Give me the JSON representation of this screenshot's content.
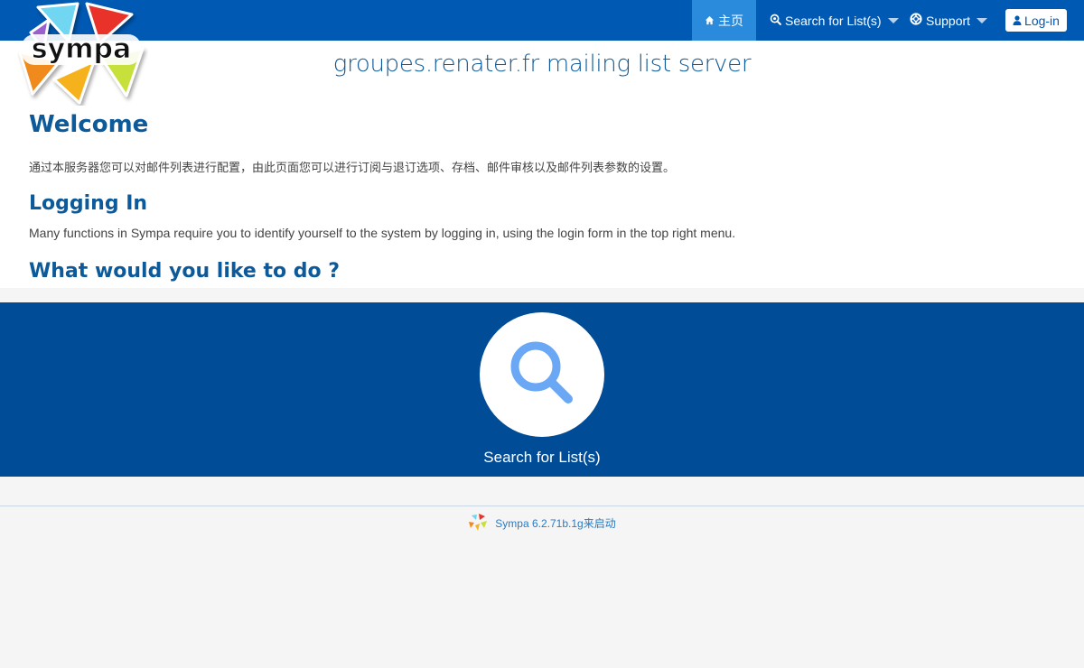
{
  "header": {
    "nav": {
      "home_label": "主页",
      "search_label": "Search for List(s)",
      "support_label": "Support",
      "login_label": "Log-in"
    },
    "icons": {
      "home": "home-icon",
      "search": "search-icon",
      "support": "lifebuoy-icon",
      "login": "user-icon"
    },
    "colors": {
      "topbar": "#0059b3",
      "active_tab": "#2a8bdc",
      "heading": "#0d5a9a",
      "action_band": "#004c97"
    }
  },
  "logo": {
    "text": "sympa"
  },
  "main": {
    "site_title": "groupes.renater.fr mailing list server",
    "welcome_heading": "Welcome",
    "welcome_text": "通过本服务器您可以对邮件列表进行配置，由此页面您可以进行订阅与退订选项、存档、邮件审核以及邮件列表参数的设置。",
    "login_heading": "Logging In",
    "login_text": "Many functions in Sympa require you to identify yourself to the system by logging in, using the login form in the top right menu.",
    "todo_heading": "What would you like to do ?"
  },
  "actions": {
    "search_label": "Search for List(s)"
  },
  "footer": {
    "text": "Sympa 6.2.71b.1g来启动"
  }
}
